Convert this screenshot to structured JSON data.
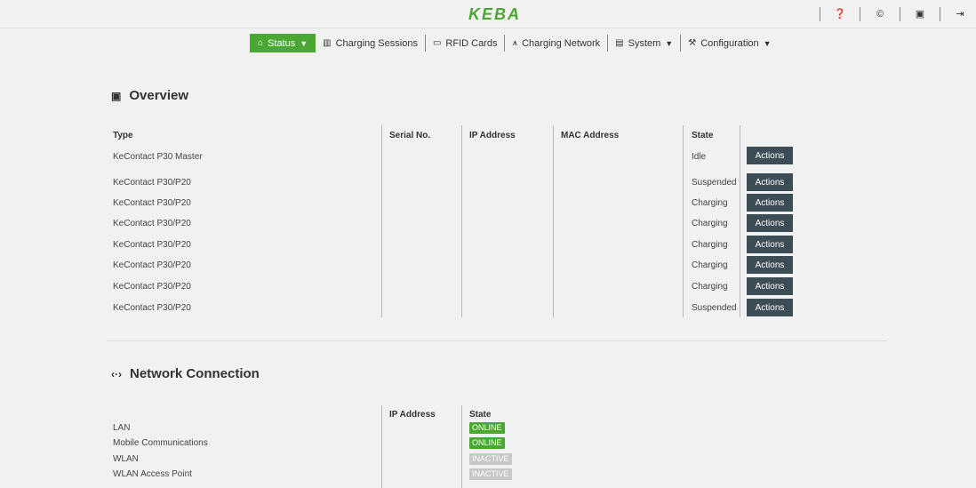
{
  "app": {
    "logo": "KEBA"
  },
  "topbar": {
    "icons": [
      "help-icon",
      "copyright-icon",
      "user-card-icon",
      "logout-icon"
    ],
    "glyphs": [
      "❓",
      "©",
      "▣",
      "⇥"
    ]
  },
  "nav": {
    "items": [
      {
        "label": "Status",
        "icon": "home-icon",
        "glyph": "⌂",
        "caret": "▼"
      },
      {
        "label": "Charging Sessions",
        "icon": "charging-sessions-icon",
        "glyph": "▥"
      },
      {
        "label": "RFID Cards",
        "icon": "rfid-card-icon",
        "glyph": "▭"
      },
      {
        "label": "Charging Network",
        "icon": "network-icon",
        "glyph": "⩚"
      },
      {
        "label": "System",
        "icon": "system-icon",
        "glyph": "▤",
        "caret": "▼"
      },
      {
        "label": "Configuration",
        "icon": "wrench-icon",
        "glyph": "⚒",
        "caret": "▼"
      }
    ]
  },
  "overview": {
    "title": "Overview",
    "icon": "calendar-icon",
    "glyph": "▣",
    "columns": [
      "Type",
      "Serial No.",
      "IP Address",
      "MAC Address",
      "State"
    ],
    "action_label": "Actions",
    "rows": [
      {
        "type": "KeContact P30 Master",
        "state": "Idle"
      },
      {
        "type": "KeContact P30/P20",
        "state": "Suspended"
      },
      {
        "type": "KeContact P30/P20",
        "state": "Charging"
      },
      {
        "type": "KeContact P30/P20",
        "state": "Charging"
      },
      {
        "type": "KeContact P30/P20",
        "state": "Charging"
      },
      {
        "type": "KeContact P30/P20",
        "state": "Charging"
      },
      {
        "type": "KeContact P30/P20",
        "state": "Charging"
      },
      {
        "type": "KeContact P30/P20",
        "state": "Suspended"
      }
    ]
  },
  "network": {
    "title": "Network Connection",
    "icon": "arrows-icon",
    "glyph": "‹·›",
    "columns": [
      "IP Address",
      "State"
    ],
    "rows": [
      {
        "name": "LAN",
        "state": "ONLINE"
      },
      {
        "name": "Mobile Communications",
        "state": "ONLINE"
      },
      {
        "name": "WLAN",
        "state": "INACTIVE"
      },
      {
        "name": "WLAN Access Point",
        "state": "INACTIVE"
      }
    ]
  },
  "colors": {
    "accent": "#4aa832",
    "button": "#3d4d56",
    "inactive": "#c7c7c7"
  }
}
